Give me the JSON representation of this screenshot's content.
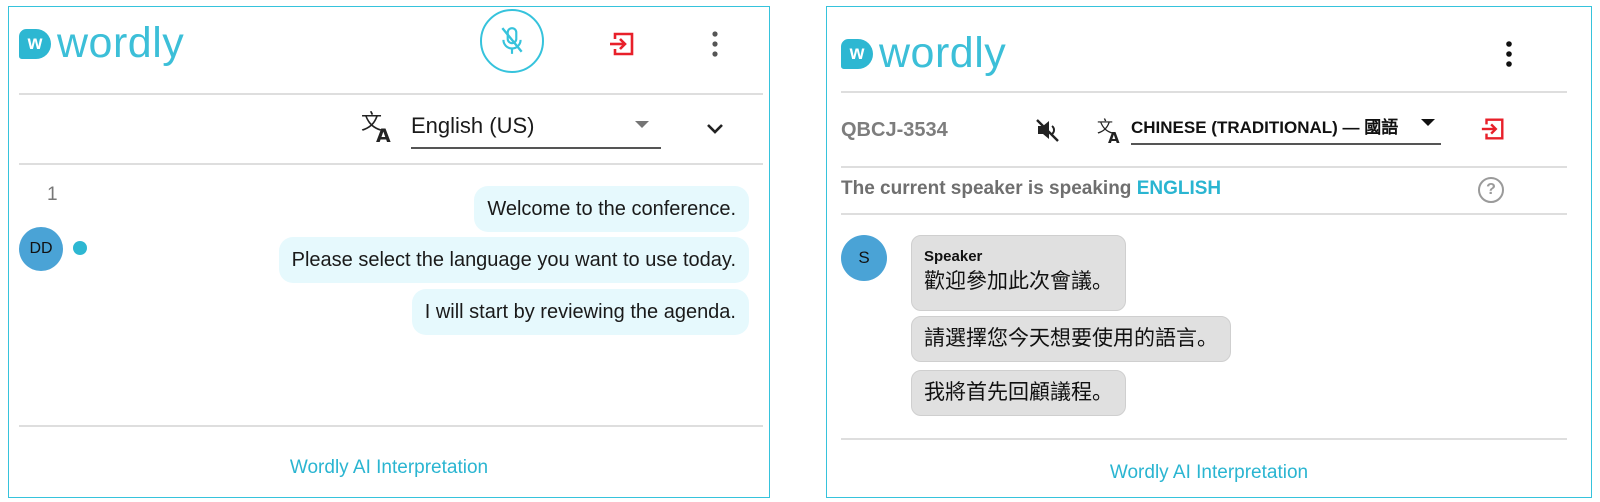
{
  "left": {
    "logo_letter": "w",
    "logo_text": "wordly",
    "language": {
      "selected": "English (US)"
    },
    "message_number": "1",
    "speaker_initials": "DD",
    "messages": [
      "Welcome to the conference.",
      "Please select the language you want to use today.",
      "I will start by reviewing the agenda."
    ],
    "footer": "Wordly AI Interpretation"
  },
  "right": {
    "logo_letter": "w",
    "logo_text": "wordly",
    "session_code": "QBCJ-3534",
    "language": {
      "selected": "CHINESE (TRADITIONAL) — 國語"
    },
    "speaking_status": {
      "prefix": "The current speaker is speaking",
      "language": "ENGLISH"
    },
    "help_icon_text": "?",
    "speaker_initial": "S",
    "speaker_label": "Speaker",
    "messages": [
      "歡迎參加此次會議。",
      "請選擇您今天想要使用的語言。",
      "我將首先回顧議程。"
    ],
    "footer": "Wordly AI Interpretation"
  },
  "colors": {
    "accent": "#36c3dc",
    "exit_red": "#e8202a",
    "bubble_left": "#e6f9fd",
    "bubble_right": "#e0e0e0",
    "avatar": "#4aa3d6"
  },
  "icons": [
    "mic-off-icon",
    "exit-icon",
    "more-vert-icon",
    "translate-icon",
    "caret-down-icon",
    "chevron-down-icon",
    "speaker-muted-icon",
    "help-icon"
  ]
}
